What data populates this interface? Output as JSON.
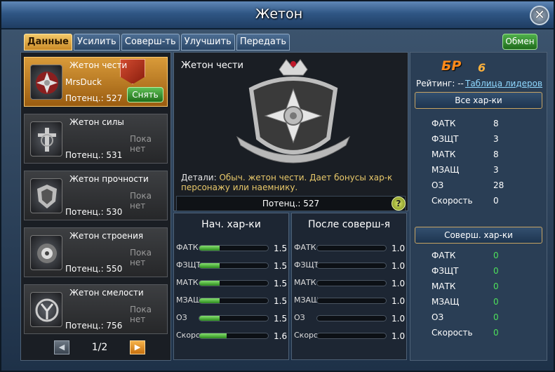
{
  "window": {
    "title": "Жетон"
  },
  "tabs": [
    "Данные",
    "Усилить",
    "Соверш-ть",
    "Улучшить",
    "Передать"
  ],
  "exchange_label": "Обмен",
  "tokens": [
    {
      "name": "Жетон чести",
      "owner": "MrsDuck",
      "potential": "Потенц.: 527",
      "action": "Снять"
    },
    {
      "name": "Жетон силы",
      "status": "Пока нет",
      "potential": "Потенц.: 531"
    },
    {
      "name": "Жетон прочности",
      "status": "Пока нет",
      "potential": "Потенц.: 530"
    },
    {
      "name": "Жетон строения",
      "status": "Пока нет",
      "potential": "Потенц.: 550"
    },
    {
      "name": "Жетон смелости",
      "status": "Пока нет",
      "potential": "Потенц.: 756"
    }
  ],
  "pager": {
    "text": "1/2"
  },
  "detail": {
    "title": "Жетон чести",
    "details_label": "Детали:",
    "details_text": "Обыч. жетон чести. Дает бонусы хар-к персонажу или наемнику.",
    "potential": "Потенц.: 527",
    "help": "?"
  },
  "base_stats": {
    "title": "Нач. хар-ки",
    "rows": [
      {
        "label": "ФАТК",
        "value": "1.5",
        "fill": 0.3
      },
      {
        "label": "ФЗЩТ",
        "value": "1.5",
        "fill": 0.3
      },
      {
        "label": "МАТК",
        "value": "1.5",
        "fill": 0.3
      },
      {
        "label": "МЗАЩ",
        "value": "1.5",
        "fill": 0.3
      },
      {
        "label": "ОЗ",
        "value": "1.5",
        "fill": 0.3
      },
      {
        "label": "Скорость",
        "value": "1.6",
        "fill": 0.4
      }
    ]
  },
  "after_stats": {
    "title": "После соверш-я",
    "rows": [
      {
        "label": "ФАТК",
        "value": "1.0",
        "fill": 0.0
      },
      {
        "label": "ФЗЩТ",
        "value": "1.0",
        "fill": 0.0
      },
      {
        "label": "МАТК",
        "value": "1.0",
        "fill": 0.0
      },
      {
        "label": "МЗАЩ",
        "value": "1.0",
        "fill": 0.0
      },
      {
        "label": "ОЗ",
        "value": "1.0",
        "fill": 0.0
      },
      {
        "label": "Скорость",
        "value": "1.0",
        "fill": 0.0
      }
    ]
  },
  "rank": {
    "label": "БР",
    "value": "6",
    "rating_label": "Рейтинг: --",
    "leaders_link": "Таблица лидеров"
  },
  "all_stats": {
    "title": "Все хар-ки",
    "rows": [
      {
        "label": "ФАТК",
        "value": "8"
      },
      {
        "label": "ФЗЩТ",
        "value": "3"
      },
      {
        "label": "МАТК",
        "value": "8"
      },
      {
        "label": "МЗАЩ",
        "value": "3"
      },
      {
        "label": "ОЗ",
        "value": "28"
      },
      {
        "label": "Скорость",
        "value": "0"
      }
    ]
  },
  "perfect_stats": {
    "title": "Соверш. хар-ки",
    "rows": [
      {
        "label": "ФАТК",
        "value": "0"
      },
      {
        "label": "ФЗЩТ",
        "value": "0"
      },
      {
        "label": "МАТК",
        "value": "0"
      },
      {
        "label": "МЗАЩ",
        "value": "0"
      },
      {
        "label": "ОЗ",
        "value": "0"
      },
      {
        "label": "Скорость",
        "value": "0"
      }
    ]
  }
}
